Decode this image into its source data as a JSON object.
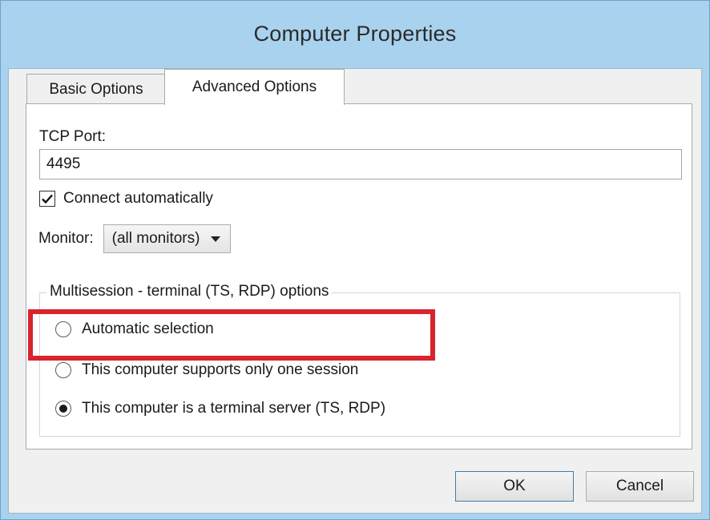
{
  "window": {
    "title": "Computer Properties"
  },
  "tabs": [
    {
      "label": "Basic Options",
      "selected": false
    },
    {
      "label": "Advanced Options",
      "selected": true
    }
  ],
  "advanced": {
    "tcp_port_label": "TCP Port:",
    "tcp_port_value": "4495",
    "connect_automatically": {
      "label": "Connect automatically",
      "checked": true
    },
    "monitor": {
      "label": "Monitor:",
      "selected": "(all monitors)"
    },
    "multisession": {
      "legend": "Multisession - terminal (TS, RDP) options",
      "options": [
        {
          "label": "Automatic selection",
          "selected": false
        },
        {
          "label": "This computer supports only one session",
          "selected": false
        },
        {
          "label": "This computer is a terminal server (TS, RDP)",
          "selected": true
        }
      ]
    }
  },
  "buttons": {
    "ok": "OK",
    "cancel": "Cancel"
  },
  "colors": {
    "frame": "#a9d2ee",
    "highlight": "#d9232d"
  }
}
